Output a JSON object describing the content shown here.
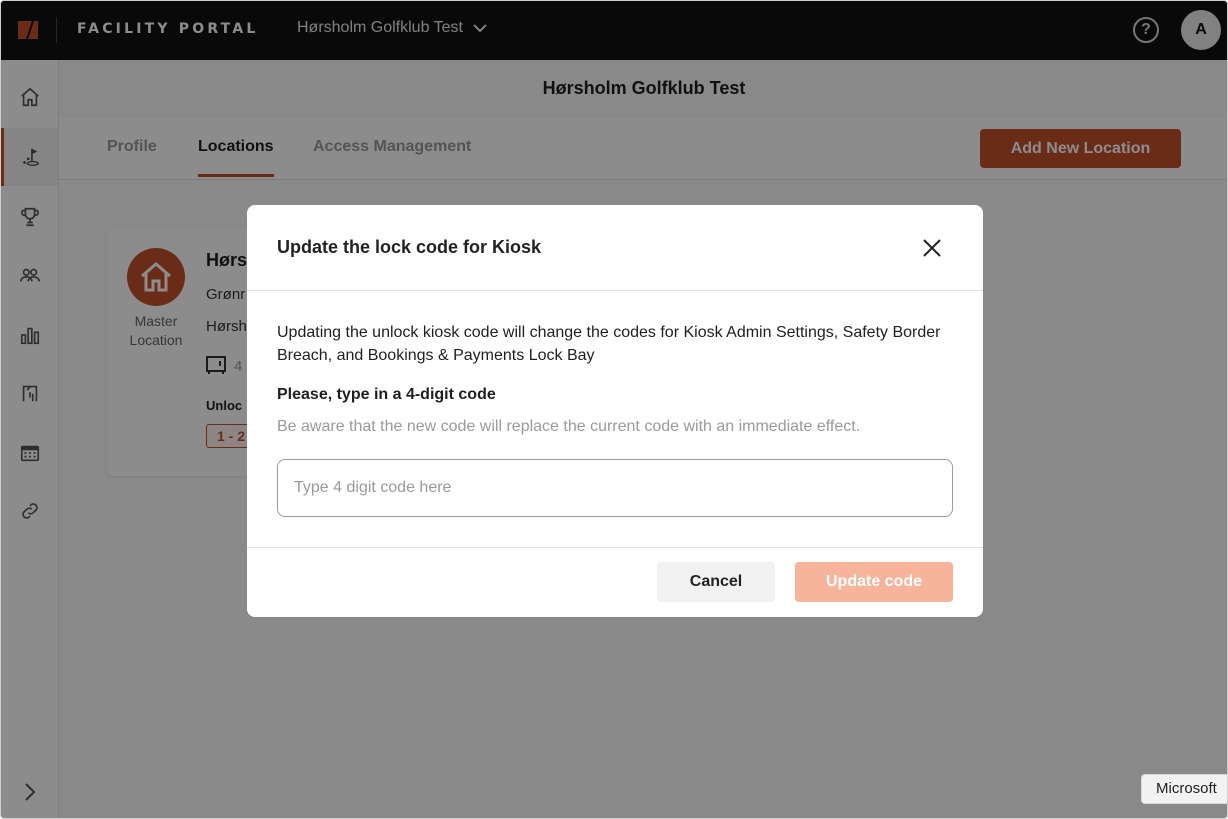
{
  "colors": {
    "brand_orange": "#c4502a",
    "update_disabled": "#f6b49a",
    "topbar_bg": "#111111"
  },
  "topbar": {
    "brand": "FACILITY PORTAL",
    "org_name": "Hørsholm Golfklub Test",
    "help_label": "?",
    "avatar_initial": "A"
  },
  "sidebar": {
    "items": [
      {
        "icon": "home-icon"
      },
      {
        "icon": "golf-course-icon"
      },
      {
        "icon": "trophy-icon"
      },
      {
        "icon": "members-icon"
      },
      {
        "icon": "bar-chart-icon"
      },
      {
        "icon": "locker-icon"
      },
      {
        "icon": "calendar-icon"
      },
      {
        "icon": "link-icon"
      }
    ],
    "active_index": 1
  },
  "main": {
    "title": "Hørsholm Golfklub Test",
    "tabs": [
      {
        "label": "Profile"
      },
      {
        "label": "Locations"
      },
      {
        "label": "Access Management"
      }
    ],
    "active_tab": "Locations",
    "add_button": "Add New Location",
    "location_card": {
      "name": "Hørs",
      "line1": "Grønr",
      "line2": "Hørsh",
      "lock_count": "4",
      "master_label": "Master Location",
      "lock_label": "Unloc",
      "code_badge": "1 - 2"
    }
  },
  "modal": {
    "title": "Update the lock code for Kiosk",
    "description": "Updating the unlock kiosk code will change the codes for Kiosk Admin Settings, Safety Border Breach, and Bookings & Payments Lock Bay",
    "label": "Please, type in a 4-digit code",
    "hint": "Be aware that the new code will replace the current code with an immediate effect.",
    "input_placeholder": "Type 4 digit code here",
    "input_value": "",
    "cancel_label": "Cancel",
    "update_label": "Update code"
  },
  "tooltip": {
    "text": "Microsoft"
  }
}
